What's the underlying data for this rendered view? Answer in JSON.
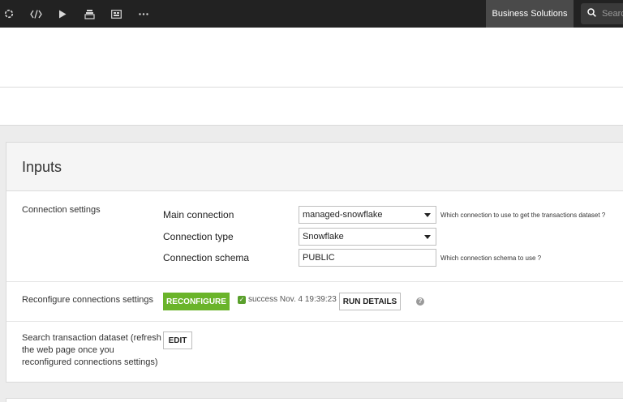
{
  "topbar": {
    "icons": [
      "flow-icon",
      "code-icon",
      "run-icon",
      "stack-icon",
      "dashboard-icon",
      "more-icon"
    ],
    "project_label": "Business Solutions",
    "search_placeholder": "Search"
  },
  "inputs": {
    "title": "Inputs",
    "connection_settings": {
      "label": "Connection settings",
      "main_connection": {
        "label": "Main connection",
        "value": "managed-snowflake",
        "help": "Which connection to use to get the transactions dataset ?"
      },
      "connection_type": {
        "label": "Connection type",
        "value": "Snowflake"
      },
      "connection_schema": {
        "label": "Connection schema",
        "value": "PUBLIC",
        "help": "Which connection schema to use ?"
      }
    },
    "reconfigure": {
      "label": "Reconfigure connections settings",
      "button": "RECONFIGURE",
      "status": "success Nov. 4 19:39:23",
      "run_details": "RUN DETAILS",
      "help_glyph": "?"
    },
    "search_dataset": {
      "label": "Search transaction dataset (refresh the web page once you reconfigured connections settings)",
      "button": "EDIT"
    }
  },
  "colors": {
    "topbar_bg": "#222222",
    "accent_green": "#6ab42a"
  }
}
